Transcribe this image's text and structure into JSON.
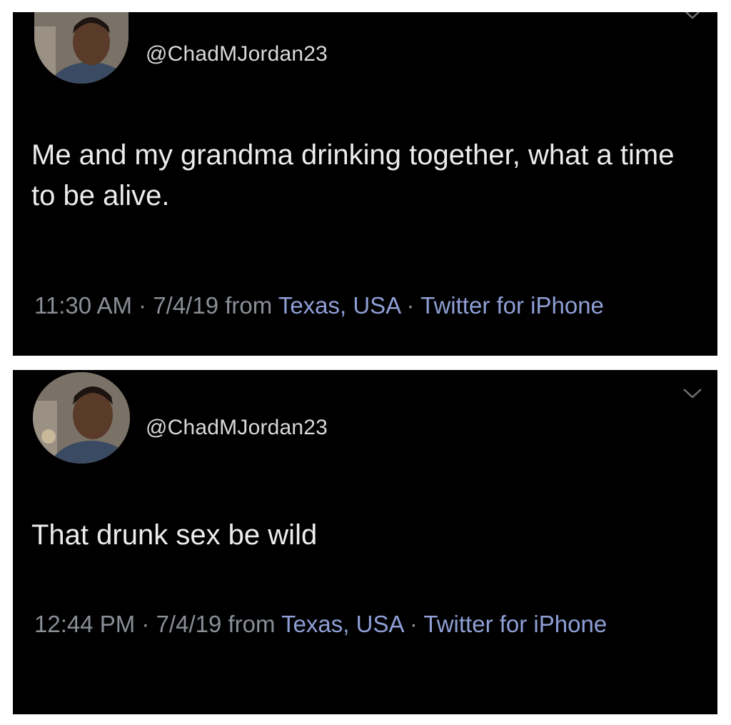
{
  "colors": {
    "panel_background": "#000000",
    "page_background": "#ffffff",
    "text": "#ececec",
    "handle": "#d9d9d9",
    "meta": "#8a8f96",
    "link": "#8f9fd6"
  },
  "tweets": [
    {
      "handle": "@ChadMJordan23",
      "text": "Me and my grandma drinking together, what a time to be alive.",
      "time": "11:30 AM",
      "sep1": " · ",
      "date": "7/4/19",
      "from_word": " from ",
      "location": "Texas, USA",
      "sep2": " · ",
      "source": "Twitter for iPhone"
    },
    {
      "handle": "@ChadMJordan23",
      "text": "That drunk sex be wild",
      "time": "12:44 PM",
      "sep1": " · ",
      "date": "7/4/19",
      "from_word": " from ",
      "location": "Texas, USA",
      "sep2": " · ",
      "source": "Twitter for iPhone"
    }
  ]
}
